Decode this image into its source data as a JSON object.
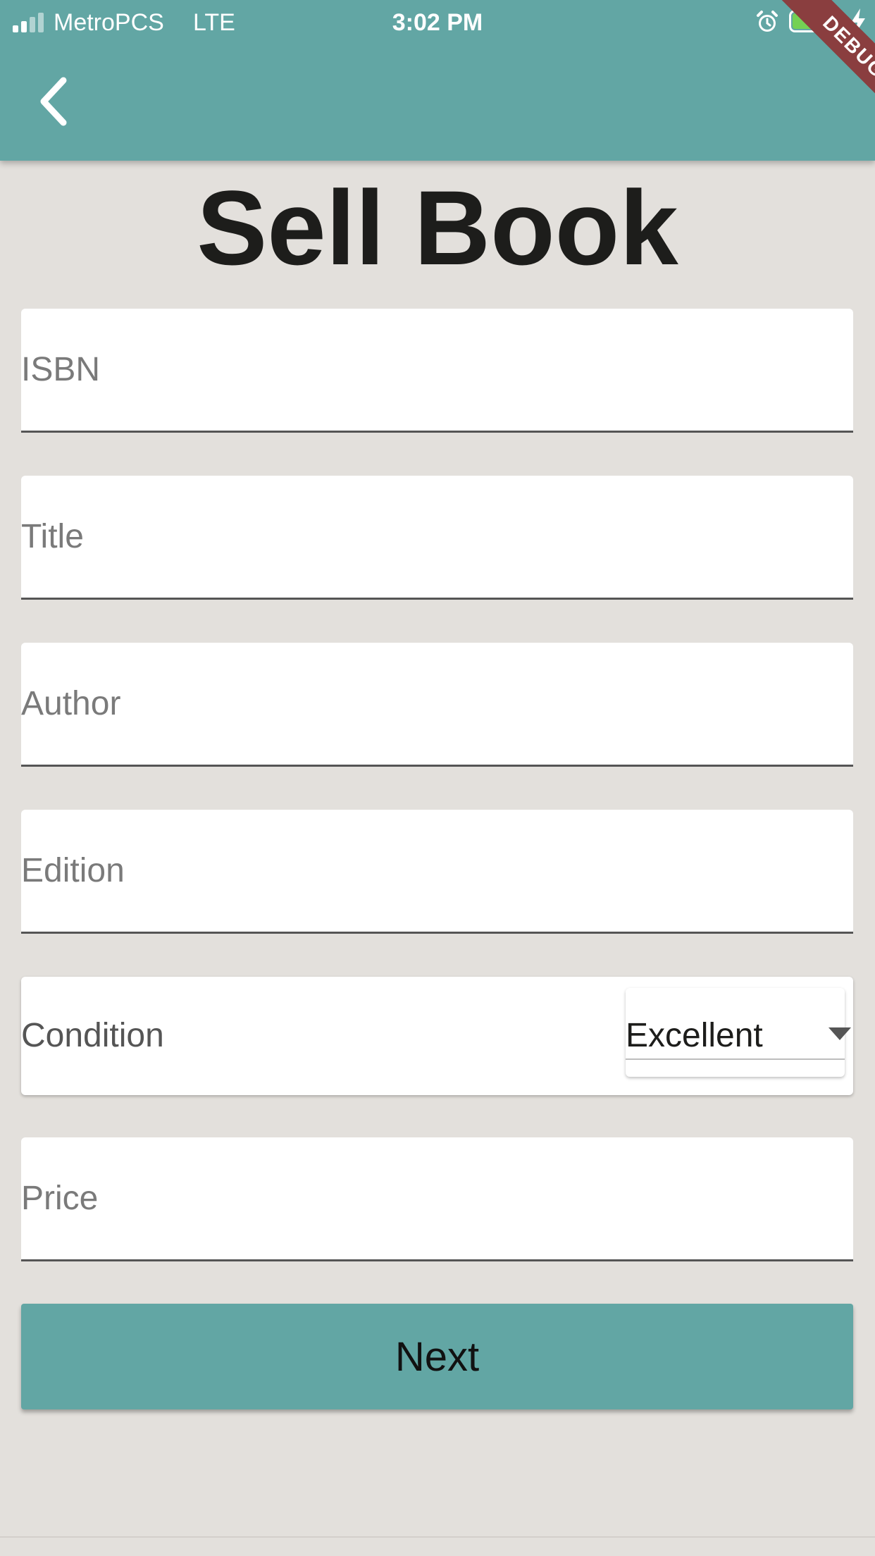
{
  "status_bar": {
    "carrier": "MetroPCS",
    "network": "LTE",
    "time": "3:02 PM",
    "icons": [
      "signal-icon",
      "alarm-icon",
      "battery-icon",
      "charging-bolt-icon"
    ]
  },
  "app_bar": {
    "back_icon": "chevron-left-icon",
    "debug_banner": "DEBUG"
  },
  "page": {
    "title": "Sell Book"
  },
  "form": {
    "isbn": {
      "placeholder": "ISBN",
      "value": ""
    },
    "title": {
      "placeholder": "Title",
      "value": ""
    },
    "author": {
      "placeholder": "Author",
      "value": ""
    },
    "edition": {
      "placeholder": "Edition",
      "value": ""
    },
    "condition": {
      "label": "Condition",
      "selected": "Excellent"
    },
    "price": {
      "placeholder": "Price",
      "value": ""
    },
    "next_label": "Next"
  },
  "colors": {
    "accent": "#62a6a4",
    "background": "#e3e0dc",
    "debug_banner": "#8a3e3f",
    "battery_fill": "#74d154"
  }
}
